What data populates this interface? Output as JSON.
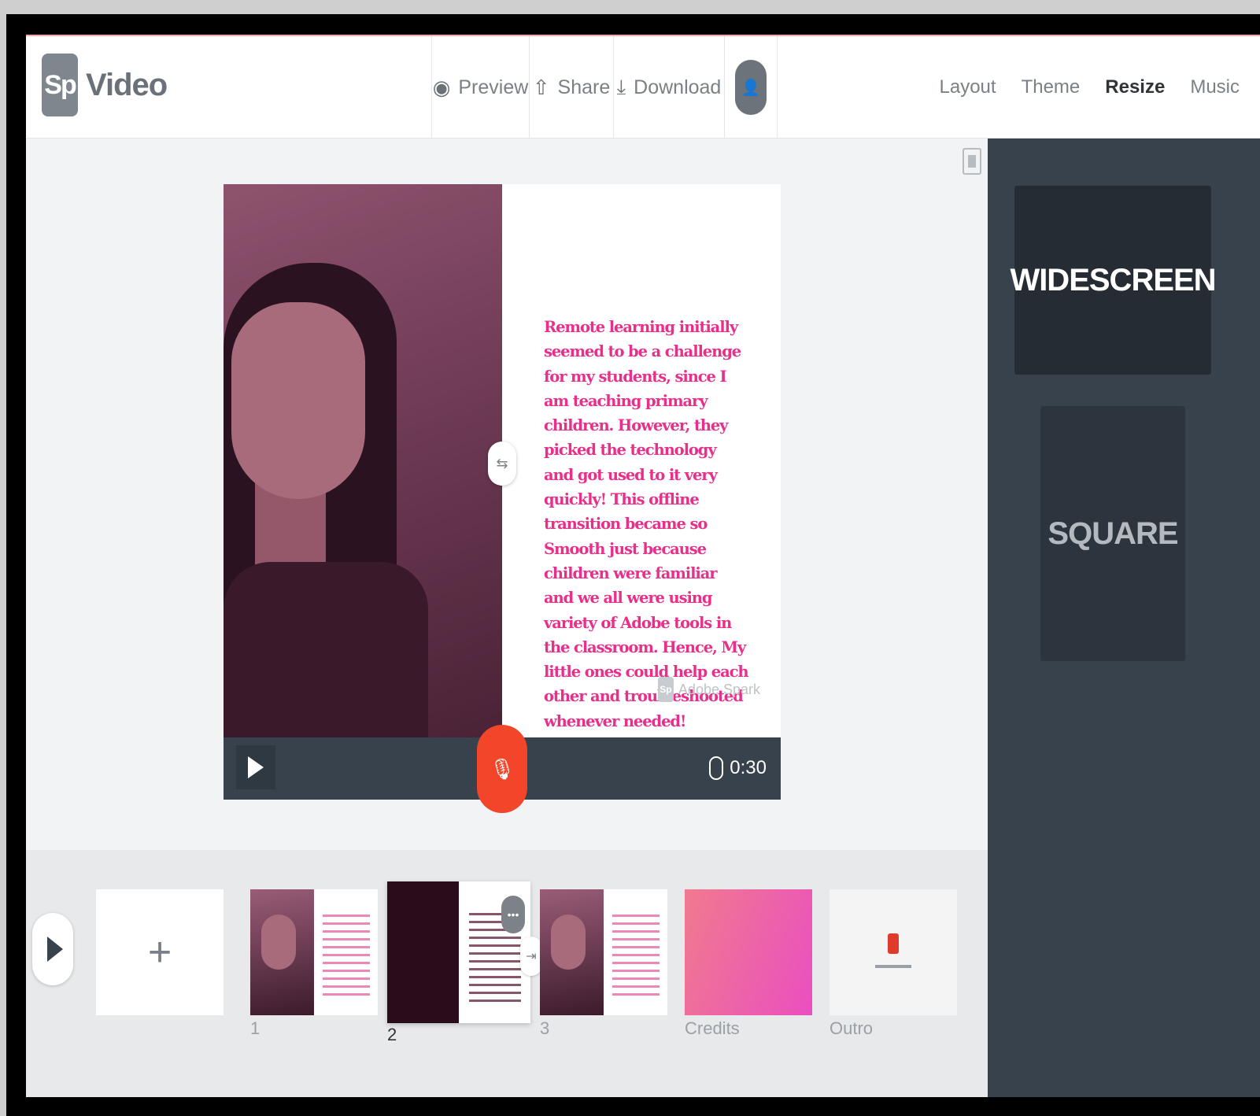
{
  "app": {
    "logo_badge": "Sp",
    "logo_text": "Video"
  },
  "header": {
    "preview": "Preview",
    "share": "Share",
    "download": "Download",
    "nav": [
      "Layout",
      "Theme",
      "Resize",
      "Music"
    ],
    "active_nav": "Resize"
  },
  "slide": {
    "text": "Remote learning initially seemed to be a challenge for my students, since I am teaching primary children. However, they picked the technology and got used to it very quickly! This offline transition became so  Smooth just because children were familiar and we all were using variety of Adobe tools in the classroom. Hence, My little ones could help each other and troubleshooted whenever needed!",
    "watermark_badge": "Sp",
    "watermark": "Adobe Spark",
    "duration": "0:30",
    "text_color": "#e8308a"
  },
  "resize_options": {
    "widescreen": "WIDESCREEN",
    "square": "SQUARE"
  },
  "timeline": {
    "add_symbol": "+",
    "labels": [
      "1",
      "2",
      "3",
      "Credits",
      "Outro"
    ],
    "selected": "2"
  },
  "colors": {
    "accent_record": "#f2452a",
    "panel_dark": "#37424c"
  }
}
